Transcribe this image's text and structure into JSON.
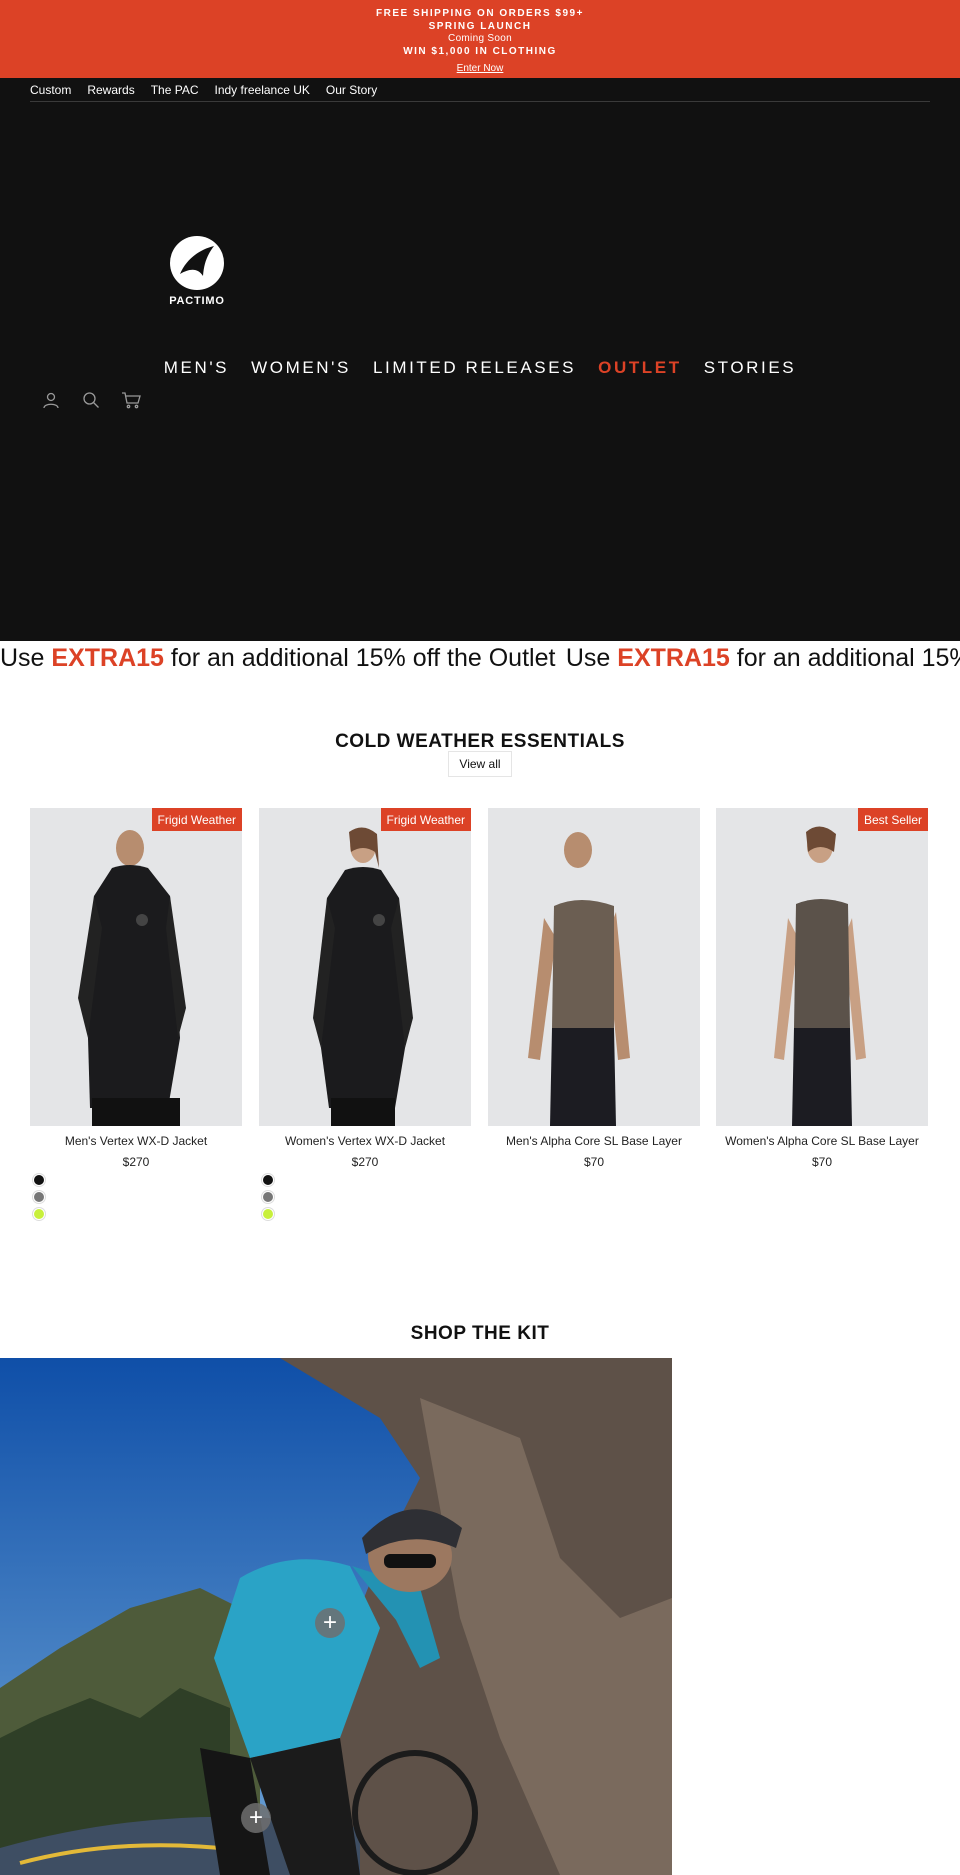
{
  "announcement": {
    "line1": "FREE SHIPPING ON ORDERS $99+",
    "line2": "SPRING LAUNCH",
    "line3": "Coming Soon",
    "line4": "WIN $1,000 IN CLOTHING",
    "link": "Enter Now",
    "bg_color": "#dc4226"
  },
  "utility_nav": [
    "Custom",
    "Rewards",
    "The PAC",
    "Indy freelance UK",
    "Our Story"
  ],
  "logo": {
    "wordmark": "PACTIMO"
  },
  "main_nav": [
    {
      "label": "MEN'S"
    },
    {
      "label": "WOMEN'S"
    },
    {
      "label": "LIMITED RELEASES"
    },
    {
      "label": "OUTLET",
      "color": "#dc4226"
    },
    {
      "label": "STORIES"
    }
  ],
  "header_icons": [
    "account-icon",
    "search-icon",
    "cart-icon"
  ],
  "marquee": {
    "prefix": "Use ",
    "code": "EXTRA15",
    "suffix": " for an additional 15% off the Outlet"
  },
  "collection": {
    "title": "COLD WEATHER ESSENTIALS",
    "view_all": "View all",
    "products": [
      {
        "name": "Men's Vertex WX-D Jacket",
        "price": "$270",
        "badge": "Frigid Weather",
        "swatches": [
          "#111111",
          "#777777",
          "#c8f03c"
        ]
      },
      {
        "name": "Women's Vertex WX-D Jacket",
        "price": "$270",
        "badge": "Frigid Weather",
        "swatches": [
          "#111111",
          "#777777",
          "#c8f03c"
        ]
      },
      {
        "name": "Men's Alpha Core SL Base Layer",
        "price": "$70",
        "badge": "",
        "swatches": []
      },
      {
        "name": "Women's Alpha Core SL Base Layer",
        "price": "$70",
        "badge": "Best Seller",
        "swatches": []
      }
    ]
  },
  "kit": {
    "title": "SHOP THE KIT"
  },
  "colors": {
    "accent": "#dc4226",
    "header_bg": "#111111"
  }
}
